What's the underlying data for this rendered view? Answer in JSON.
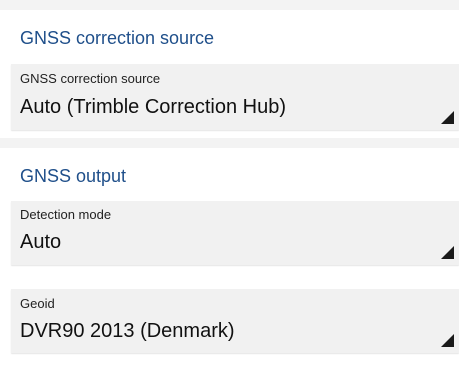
{
  "sections": {
    "correction": {
      "title": "GNSS correction source",
      "source_field": {
        "label": "GNSS correction source",
        "value": "Auto (Trimble Correction Hub)"
      }
    },
    "output": {
      "title": "GNSS output",
      "detection_field": {
        "label": "Detection mode",
        "value": "Auto"
      },
      "geoid_field": {
        "label": "Geoid",
        "value": "DVR90 2013 (Denmark)"
      }
    }
  },
  "colors": {
    "section_title": "#1f4f8a",
    "field_background": "#f1f1f1",
    "gap_background": "#f3f3f3"
  },
  "icons": {
    "dropdown": "dropdown-corner-triangle-icon"
  }
}
